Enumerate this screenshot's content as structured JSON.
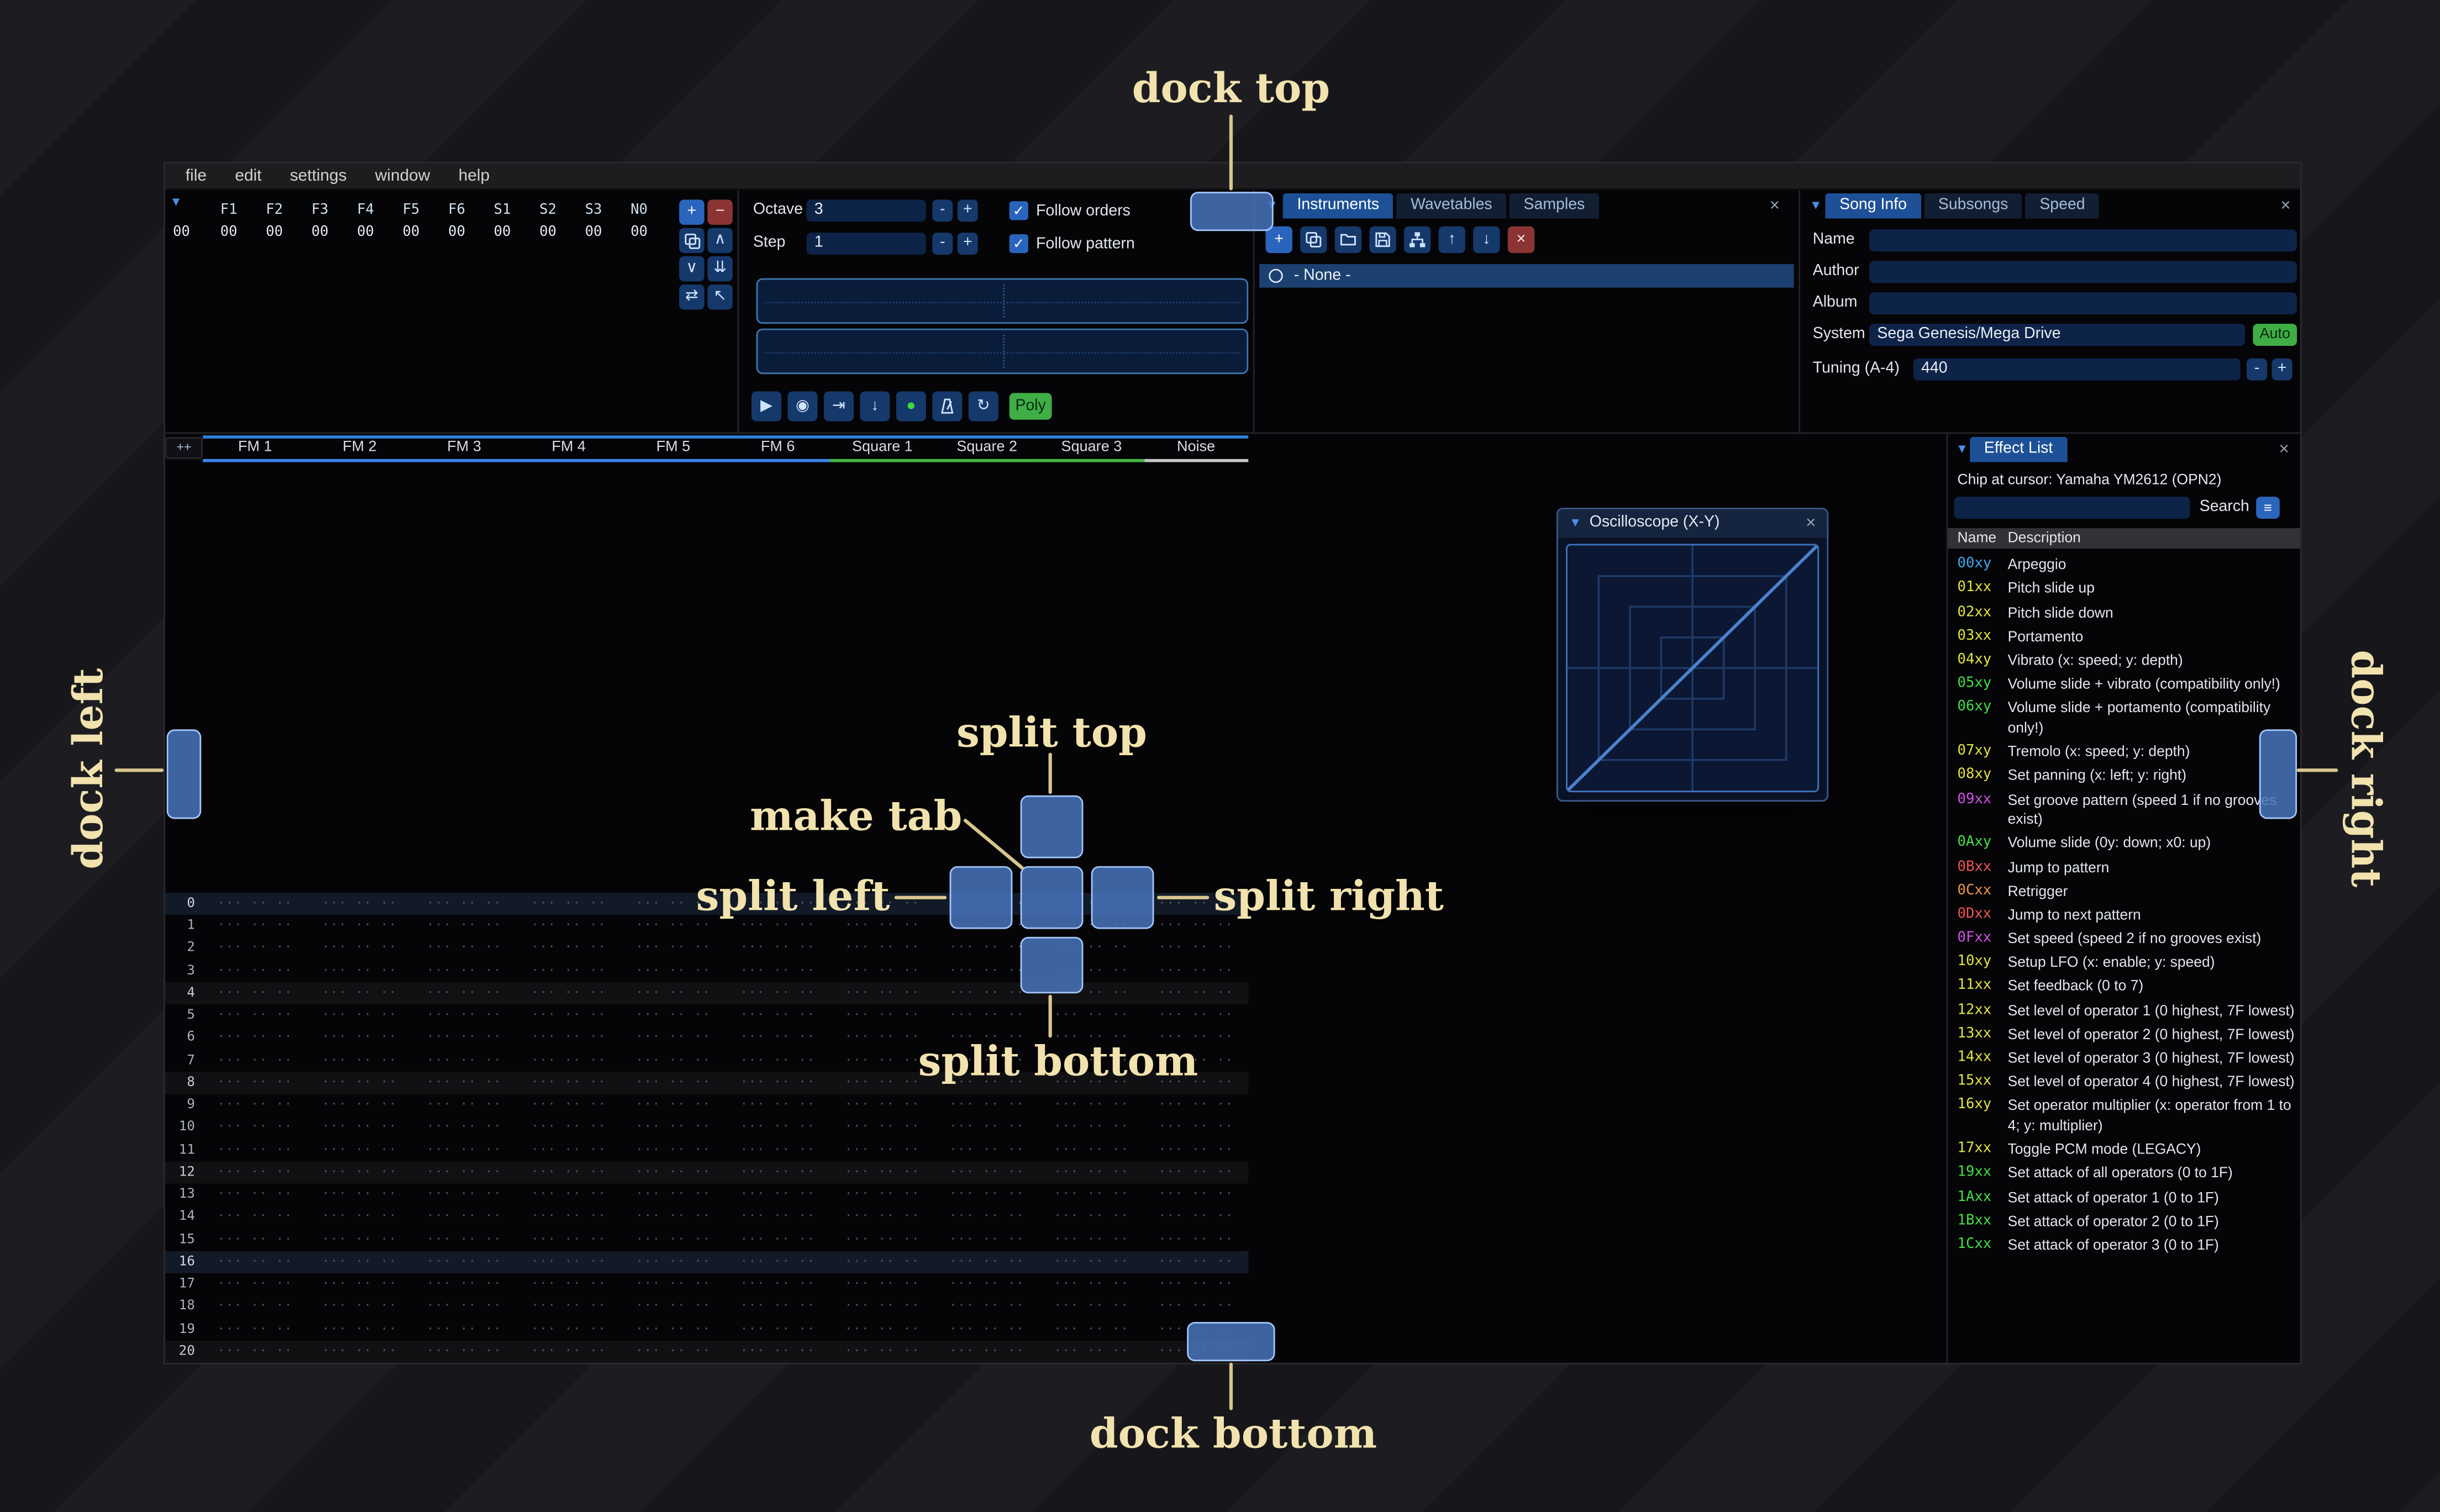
{
  "icons": {
    "minus": "-",
    "plus": "+",
    "close": "×",
    "collapse": "▼",
    "check": "✓",
    "menu": "≡"
  },
  "colors": {
    "accent_blue": "#2a65bd",
    "accent_green": "#3fae46",
    "dock_overlay_blue": "#4874bc",
    "annotation_text": "#f1e2ae",
    "fm_channel": "#3c85e6",
    "square_channel": "#43b543",
    "noise_channel": "#c6c6c6"
  },
  "menu": {
    "items": [
      "file",
      "edit",
      "settings",
      "window",
      "help"
    ]
  },
  "orders": {
    "row_index": "00",
    "headers": [
      "F1",
      "F2",
      "F3",
      "F4",
      "F5",
      "F6",
      "S1",
      "S2",
      "S3",
      "N0"
    ],
    "values": [
      "00",
      "00",
      "00",
      "00",
      "00",
      "00",
      "00",
      "00",
      "00",
      "00"
    ],
    "buttons": [
      {
        "button": "add-order-button",
        "icon": "plus-icon",
        "glyph": "+",
        "accent": "blue"
      },
      {
        "button": "remove-order-button",
        "icon": "minus-icon",
        "glyph": "−",
        "accent": "red"
      },
      {
        "button": "duplicate-order-button",
        "icon": "duplicate-icon",
        "svg": "duplicate"
      },
      {
        "button": "move-order-up-button",
        "icon": "chevron-up-icon",
        "glyph": "∧"
      },
      {
        "button": "move-order-down-button",
        "icon": "chevron-down-icon",
        "glyph": "∨"
      },
      {
        "button": "deep-clone-order-button",
        "icon": "double-down-icon",
        "glyph": "⇊"
      },
      {
        "button": "change-all-orders-button",
        "icon": "swap-icon",
        "glyph": "⇄"
      },
      {
        "button": "order-edit-mode-button",
        "icon": "pointer-icon",
        "glyph": "↖"
      }
    ]
  },
  "controls": {
    "octave": {
      "label": "Octave",
      "value": "3"
    },
    "step": {
      "label": "Step",
      "value": "1"
    },
    "follow_orders": "Follow orders",
    "follow_pattern": "Follow pattern",
    "transport": [
      {
        "button": "play-button",
        "icon": "play-icon",
        "glyph": "▶"
      },
      {
        "button": "play-from-start-button",
        "icon": "play-circle-icon",
        "glyph": "◉"
      },
      {
        "button": "play-one-row-button",
        "icon": "play-to-bar-icon",
        "glyph": "⇥"
      },
      {
        "button": "step-one-row-button",
        "icon": "arrow-down-icon",
        "glyph": "↓"
      },
      {
        "button": "edit-record-toggle-button",
        "icon": "record-icon",
        "glyph": "●",
        "accent": "green-glyph"
      },
      {
        "button": "metronome-button",
        "icon": "metronome-icon",
        "svg": "metronome"
      },
      {
        "button": "repeat-pattern-button",
        "icon": "repeat-icon",
        "glyph": "↻"
      }
    ],
    "poly_label": "Poly"
  },
  "assets": {
    "tabs": [
      {
        "label": "Instruments",
        "active": true
      },
      {
        "label": "Wavetables",
        "active": false
      },
      {
        "label": "Samples",
        "active": false
      }
    ],
    "toolbar": [
      {
        "button": "add-instrument-button",
        "icon": "plus-icon",
        "glyph": "+",
        "accent": "blue"
      },
      {
        "button": "duplicate-instrument-button",
        "icon": "duplicate-icon",
        "svg": "duplicate"
      },
      {
        "button": "open-instrument-button",
        "icon": "folder-open-icon",
        "svg": "folder"
      },
      {
        "button": "save-instrument-button",
        "icon": "floppy-icon",
        "svg": "floppy"
      },
      {
        "button": "toggle-folders-button",
        "icon": "sitemap-icon",
        "svg": "sitemap"
      },
      {
        "button": "move-instrument-up-button",
        "icon": "arrow-up-icon",
        "glyph": "↑"
      },
      {
        "button": "move-instrument-down-button",
        "icon": "arrow-down-icon",
        "glyph": "↓"
      },
      {
        "button": "delete-instrument-button",
        "icon": "delete-icon",
        "glyph": "×",
        "accent": "red"
      }
    ],
    "list": [
      {
        "label": "- None -",
        "selected": true
      }
    ]
  },
  "song_info": {
    "tabs": [
      {
        "label": "Song Info",
        "active": true
      },
      {
        "label": "Subsongs",
        "active": false
      },
      {
        "label": "Speed",
        "active": false
      }
    ],
    "fields": [
      {
        "label": "Name",
        "value": ""
      },
      {
        "label": "Author",
        "value": ""
      },
      {
        "label": "Album",
        "value": ""
      }
    ],
    "system": {
      "label": "System",
      "value": "Sega Genesis/Mega Drive",
      "auto_label": "Auto"
    },
    "tuning": {
      "label": "Tuning (A-4)",
      "value": "440"
    }
  },
  "pattern": {
    "expand_label": "++",
    "channels": [
      {
        "name": "FM 1",
        "type": "fm"
      },
      {
        "name": "FM 2",
        "type": "fm"
      },
      {
        "name": "FM 3",
        "type": "fm"
      },
      {
        "name": "FM 4",
        "type": "fm"
      },
      {
        "name": "FM 5",
        "type": "fm"
      },
      {
        "name": "FM 6",
        "type": "fm"
      },
      {
        "name": "Square 1",
        "type": "square"
      },
      {
        "name": "Square 2",
        "type": "square"
      },
      {
        "name": "Square 3",
        "type": "square"
      },
      {
        "name": "Noise",
        "type": "noise"
      }
    ],
    "row_count": 22,
    "empty_cell": "··· ·· ·· ···"
  },
  "oscilloscope": {
    "title": "Oscilloscope (X-Y)"
  },
  "effect_list": {
    "title": "Effect List",
    "chip_line": "Chip at cursor: Yamaha YM2612 (OPN2)",
    "search_label": "Search",
    "search_value": "",
    "columns": {
      "name": "Name",
      "description": "Description"
    },
    "effects": [
      {
        "code": "00xy",
        "desc": "Arpeggio",
        "color": "#41a8f0"
      },
      {
        "code": "01xx",
        "desc": "Pitch slide up",
        "color": "#e3e53c"
      },
      {
        "code": "02xx",
        "desc": "Pitch slide down",
        "color": "#e3e53c"
      },
      {
        "code": "03xx",
        "desc": "Portamento",
        "color": "#e3e53c"
      },
      {
        "code": "04xy",
        "desc": "Vibrato (x: speed; y: depth)",
        "color": "#e3e53c"
      },
      {
        "code": "05xy",
        "desc": "Volume slide + vibrato (compatibility only!)",
        "color": "#42e042"
      },
      {
        "code": "06xy",
        "desc": "Volume slide + portamento (compatibility only!)",
        "color": "#42e042"
      },
      {
        "code": "07xy",
        "desc": "Tremolo (x: speed; y: depth)",
        "color": "#e3e53c"
      },
      {
        "code": "08xy",
        "desc": "Set panning (x: left; y: right)",
        "color": "#e3e53c"
      },
      {
        "code": "09xx",
        "desc": "Set groove pattern (speed 1 if no grooves exist)",
        "color": "#d650e8"
      },
      {
        "code": "0Axy",
        "desc": "Volume slide (0y: down; x0: up)",
        "color": "#42e042"
      },
      {
        "code": "0Bxx",
        "desc": "Jump to pattern",
        "color": "#f05454"
      },
      {
        "code": "0Cxx",
        "desc": "Retrigger",
        "color": "#f09848"
      },
      {
        "code": "0Dxx",
        "desc": "Jump to next pattern",
        "color": "#f05454"
      },
      {
        "code": "0Fxx",
        "desc": "Set speed (speed 2 if no grooves exist)",
        "color": "#d650e8"
      },
      {
        "code": "10xy",
        "desc": "Setup LFO (x: enable; y: speed)",
        "color": "#e3e53c"
      },
      {
        "code": "11xx",
        "desc": "Set feedback (0 to 7)",
        "color": "#e3e53c"
      },
      {
        "code": "12xx",
        "desc": "Set level of operator 1 (0 highest, 7F lowest)",
        "color": "#e3e53c"
      },
      {
        "code": "13xx",
        "desc": "Set level of operator 2 (0 highest, 7F lowest)",
        "color": "#e3e53c"
      },
      {
        "code": "14xx",
        "desc": "Set level of operator 3 (0 highest, 7F lowest)",
        "color": "#e3e53c"
      },
      {
        "code": "15xx",
        "desc": "Set level of operator 4 (0 highest, 7F lowest)",
        "color": "#e3e53c"
      },
      {
        "code": "16xy",
        "desc": "Set operator multiplier (x: operator from 1 to 4; y: multiplier)",
        "color": "#e3e53c"
      },
      {
        "code": "17xx",
        "desc": "Toggle PCM mode (LEGACY)",
        "color": "#e3e53c"
      },
      {
        "code": "19xx",
        "desc": "Set attack of all operators (0 to 1F)",
        "color": "#42e042"
      },
      {
        "code": "1Axx",
        "desc": "Set attack of operator 1 (0 to 1F)",
        "color": "#42e042"
      },
      {
        "code": "1Bxx",
        "desc": "Set attack of operator 2 (0 to 1F)",
        "color": "#42e042"
      },
      {
        "code": "1Cxx",
        "desc": "Set attack of operator 3 (0 to 1F)",
        "color": "#42e042"
      }
    ]
  },
  "dock_overlay": {
    "dock_top": "dock top",
    "dock_bottom": "dock bottom",
    "dock_left": "dock left",
    "dock_right": "dock right",
    "split_top": "split top",
    "split_bottom": "split bottom",
    "split_left": "split left",
    "split_right": "split right",
    "make_tab": "make tab"
  }
}
